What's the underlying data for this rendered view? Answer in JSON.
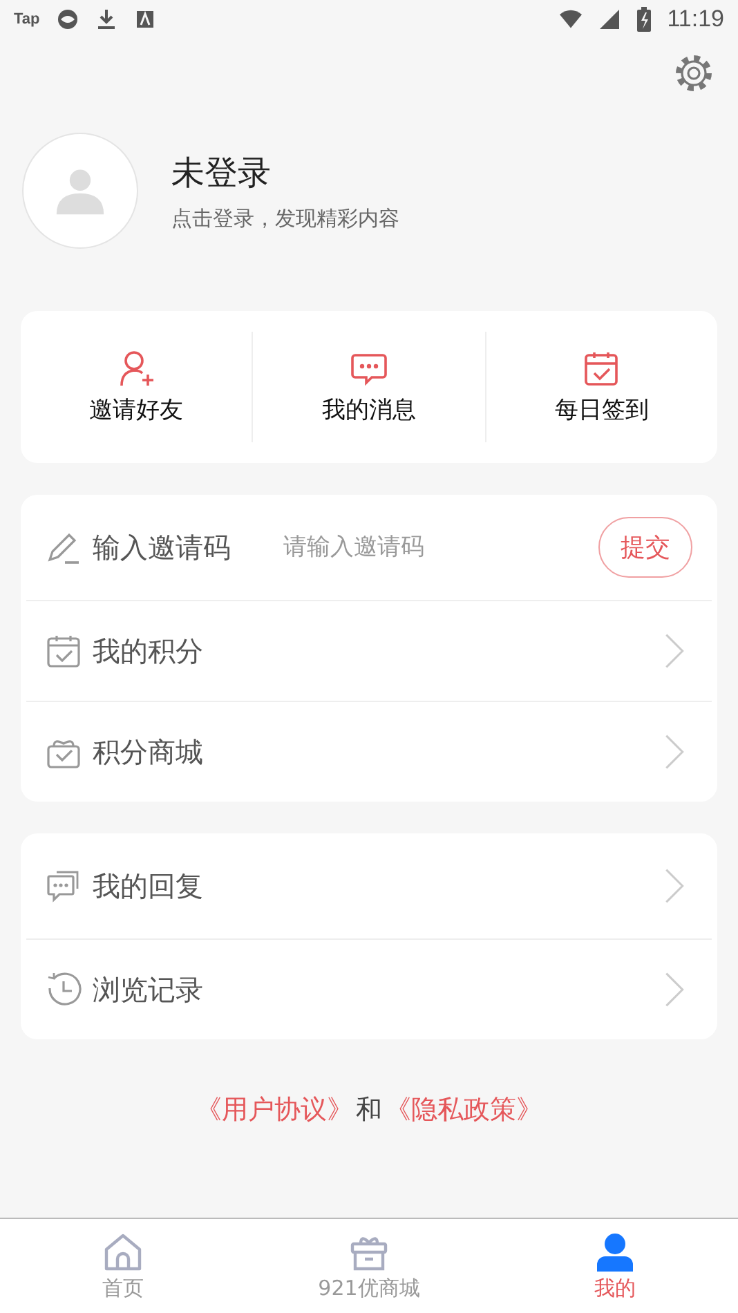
{
  "status_bar": {
    "app_label": "Tap",
    "time": "11:19"
  },
  "profile": {
    "name": "未登录",
    "hint": "点击登录，发现精彩内容"
  },
  "quick_actions": [
    {
      "kind": "invite",
      "label": "邀请好友"
    },
    {
      "kind": "message",
      "label": "我的消息"
    },
    {
      "kind": "checkin",
      "label": "每日签到"
    }
  ],
  "menu_groups": [
    [
      {
        "kind": "invite_code",
        "label": "输入邀请码",
        "placeholder": "请输入邀请码",
        "button": "提交"
      },
      {
        "kind": "points",
        "label": "我的积分"
      },
      {
        "kind": "mall",
        "label": "积分商城"
      }
    ],
    [
      {
        "kind": "replies",
        "label": "我的回复"
      },
      {
        "kind": "history",
        "label": "浏览记录"
      }
    ]
  ],
  "agreement": {
    "user_agreement": "《用户协议》",
    "conjunction": "和",
    "privacy_policy": "《隐私政策》"
  },
  "tabs": [
    {
      "kind": "home",
      "label": "首页",
      "selected": false
    },
    {
      "kind": "mall",
      "label": "921优商城",
      "selected": false
    },
    {
      "kind": "me",
      "label": "我的",
      "selected": true
    }
  ]
}
